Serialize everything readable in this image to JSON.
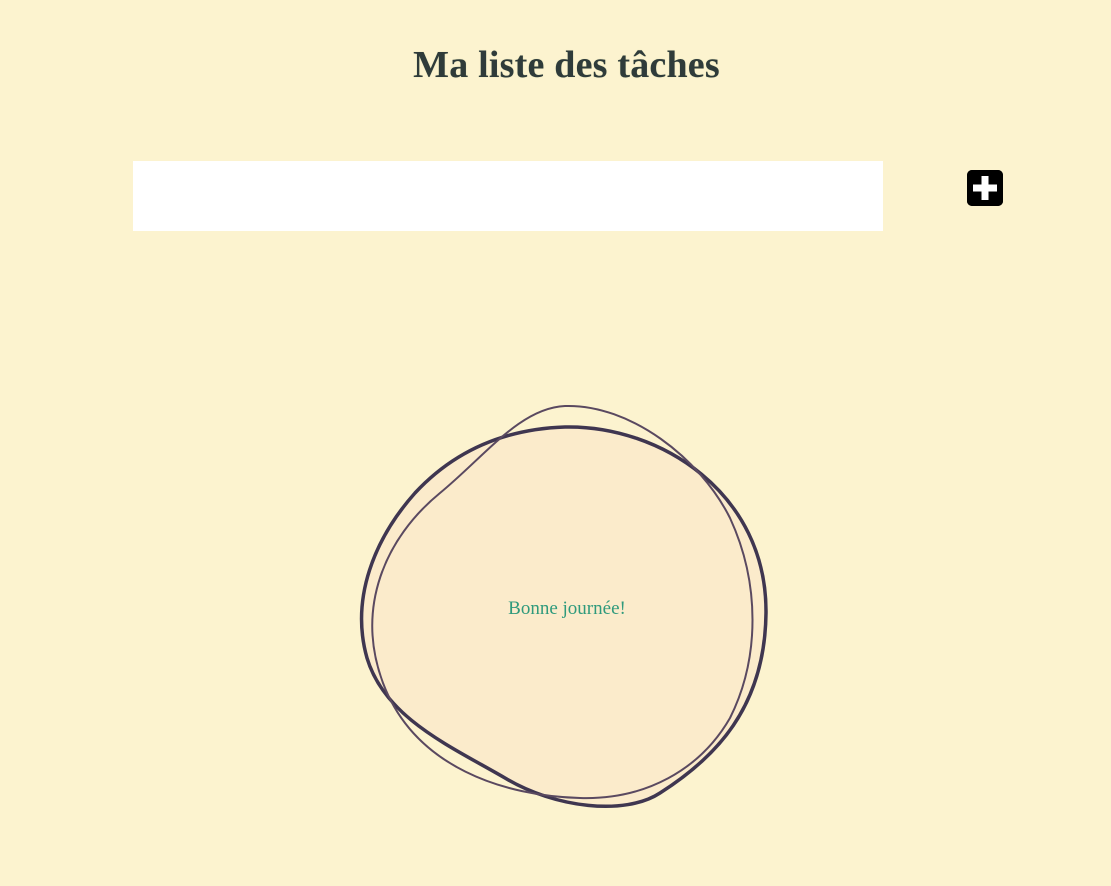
{
  "page": {
    "title": "Ma liste des tâches"
  },
  "task_form": {
    "input_value": "",
    "input_placeholder": "",
    "add_button_icon": "plus-square-icon"
  },
  "greeting": {
    "text": "Bonne journée!"
  },
  "colors": {
    "background": "#fcf3cf",
    "title": "#2f3b3a",
    "circle_fill": "#fbebcb",
    "circle_stroke": "#3f3650",
    "greeting_text": "#2f9a7c",
    "button": "#000000"
  }
}
